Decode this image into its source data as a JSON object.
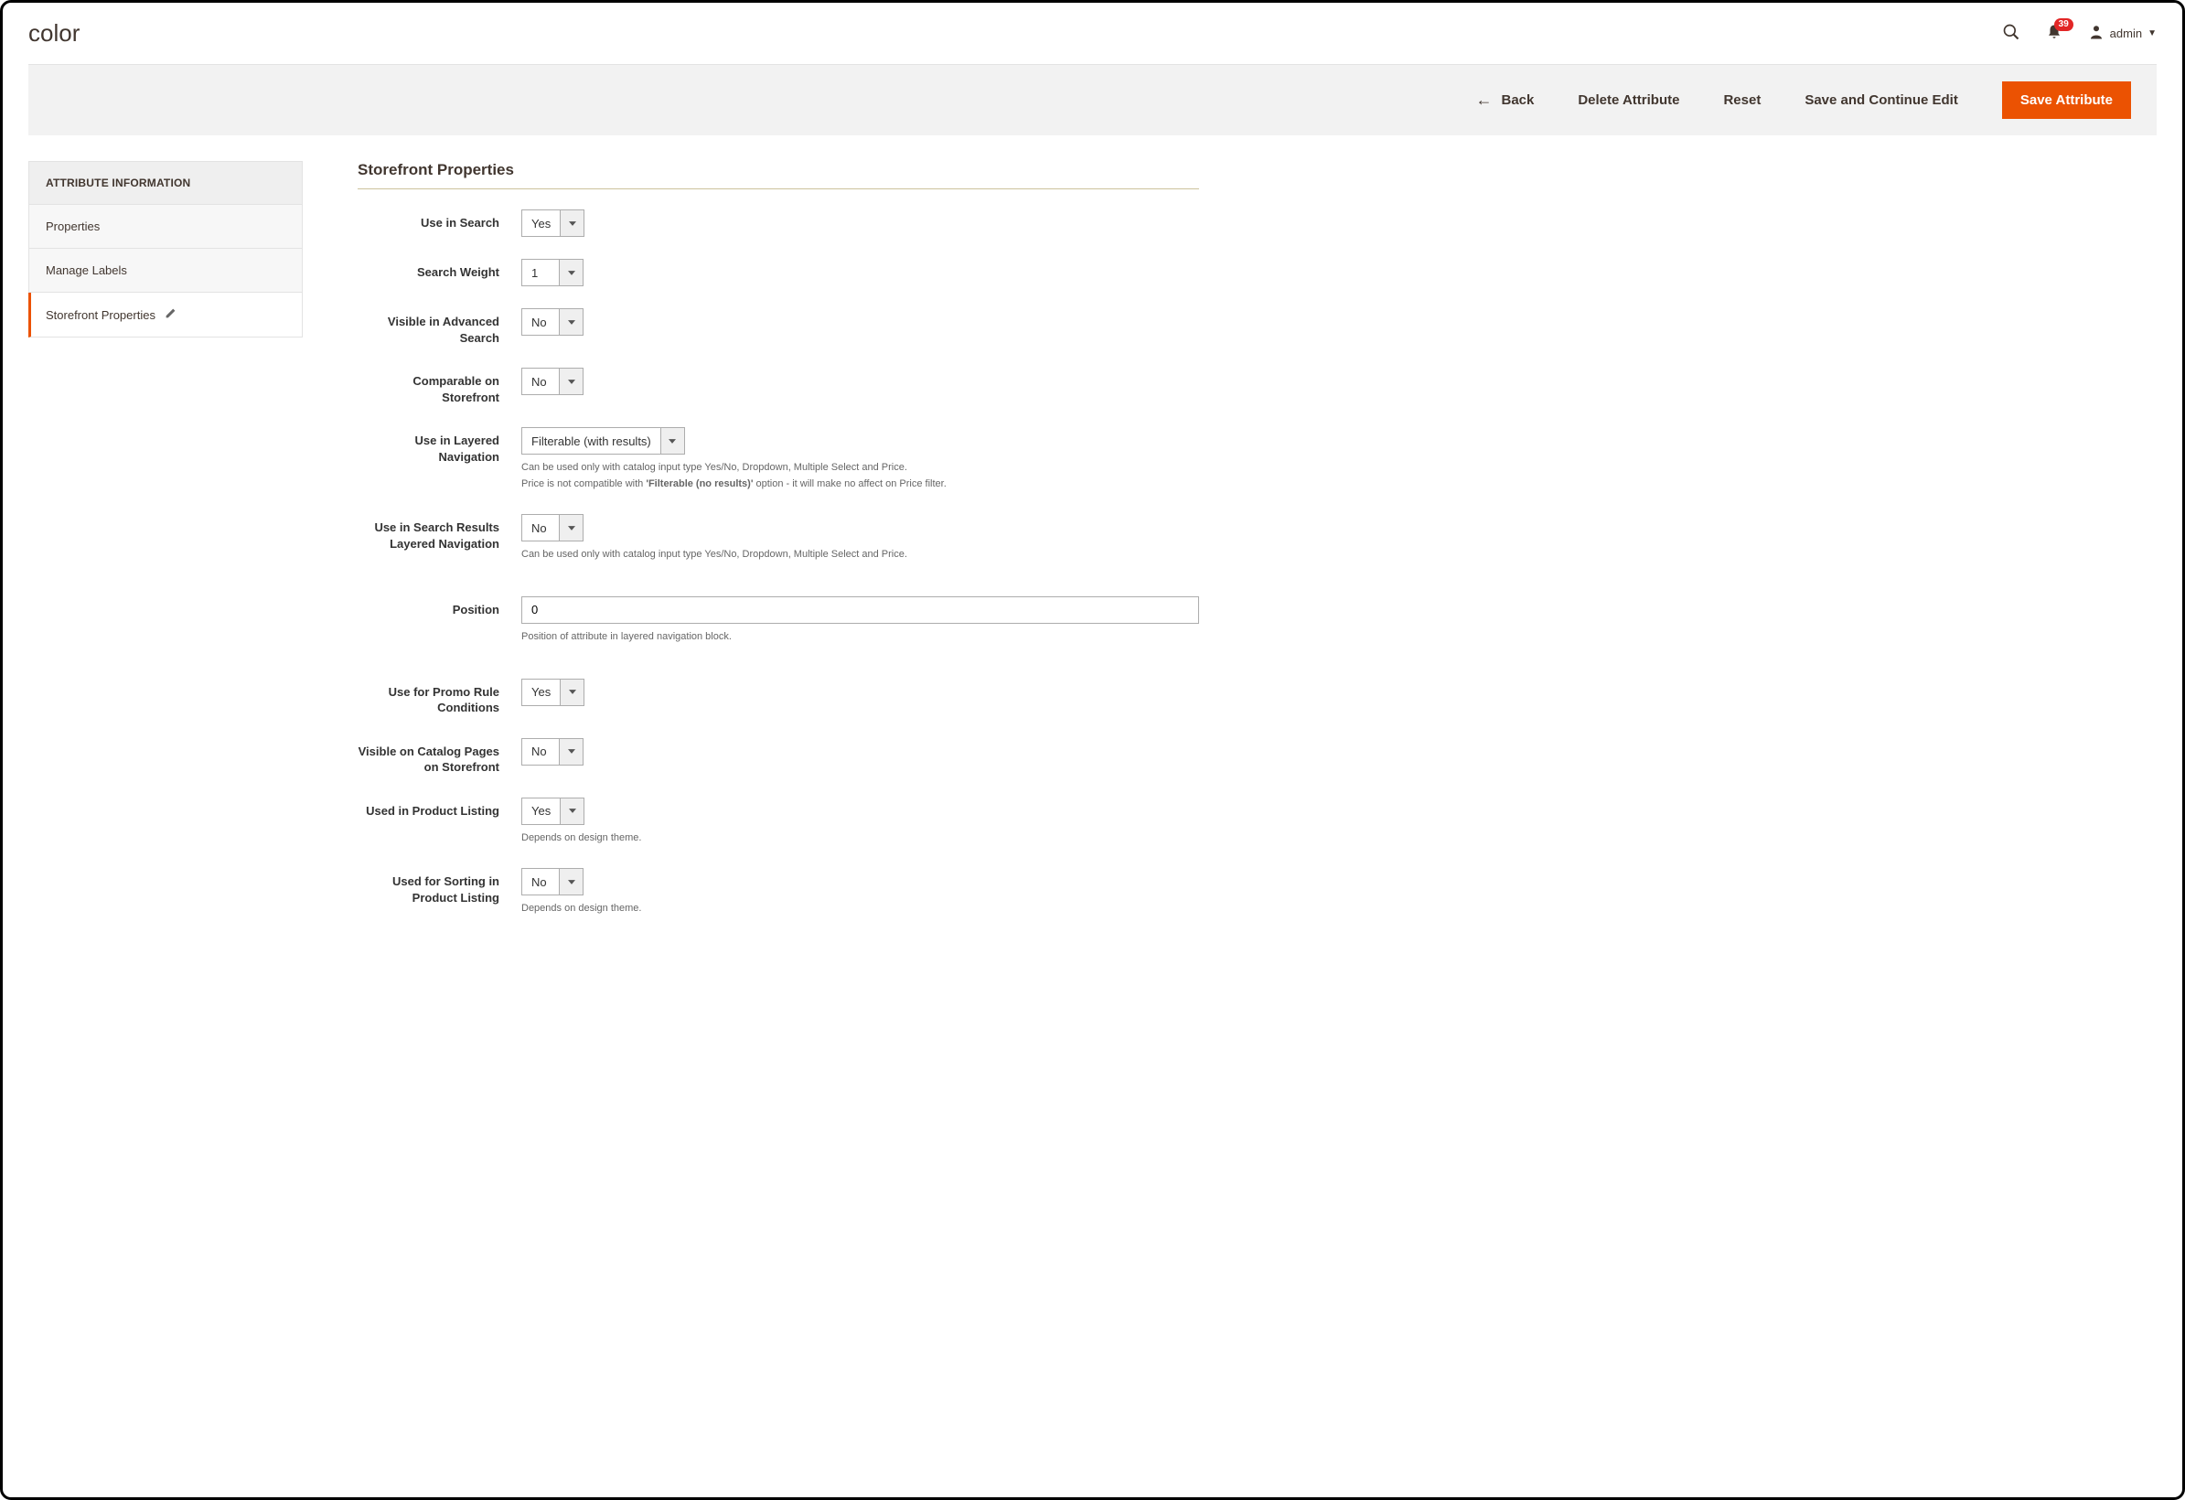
{
  "header": {
    "title": "color",
    "admin_label": "admin",
    "notification_count": "39"
  },
  "actions": {
    "back": "Back",
    "delete": "Delete Attribute",
    "reset": "Reset",
    "save_continue": "Save and Continue Edit",
    "save": "Save Attribute"
  },
  "sidebar": {
    "header": "ATTRIBUTE INFORMATION",
    "items": {
      "properties": "Properties",
      "manage_labels": "Manage Labels",
      "storefront": "Storefront Properties"
    }
  },
  "section": {
    "title": "Storefront Properties"
  },
  "form": {
    "use_in_search": {
      "label": "Use in Search",
      "value": "Yes"
    },
    "search_weight": {
      "label": "Search Weight",
      "value": "1"
    },
    "visible_advanced": {
      "label": "Visible in Advanced Search",
      "value": "No"
    },
    "comparable": {
      "label": "Comparable on Storefront",
      "value": "No"
    },
    "layered_nav": {
      "label": "Use in Layered Navigation",
      "value": "Filterable (with results)",
      "help_line1": "Can be used only with catalog input type Yes/No, Dropdown, Multiple Select and Price.",
      "help_pre": "Price is not compatible with ",
      "help_bold": "'Filterable (no results)'",
      "help_post": " option - it will make no affect on Price filter."
    },
    "search_results_layered": {
      "label": "Use in Search Results Layered Navigation",
      "value": "No",
      "help": "Can be used only with catalog input type Yes/No, Dropdown, Multiple Select and Price."
    },
    "position": {
      "label": "Position",
      "value": "0",
      "help": "Position of attribute in layered navigation block."
    },
    "promo_rules": {
      "label": "Use for Promo Rule Conditions",
      "value": "Yes"
    },
    "visible_catalog": {
      "label": "Visible on Catalog Pages on Storefront",
      "value": "No"
    },
    "product_listing": {
      "label": "Used in Product Listing",
      "value": "Yes",
      "help": "Depends on design theme."
    },
    "sorting_listing": {
      "label": "Used for Sorting in Product Listing",
      "value": "No",
      "help": "Depends on design theme."
    }
  }
}
